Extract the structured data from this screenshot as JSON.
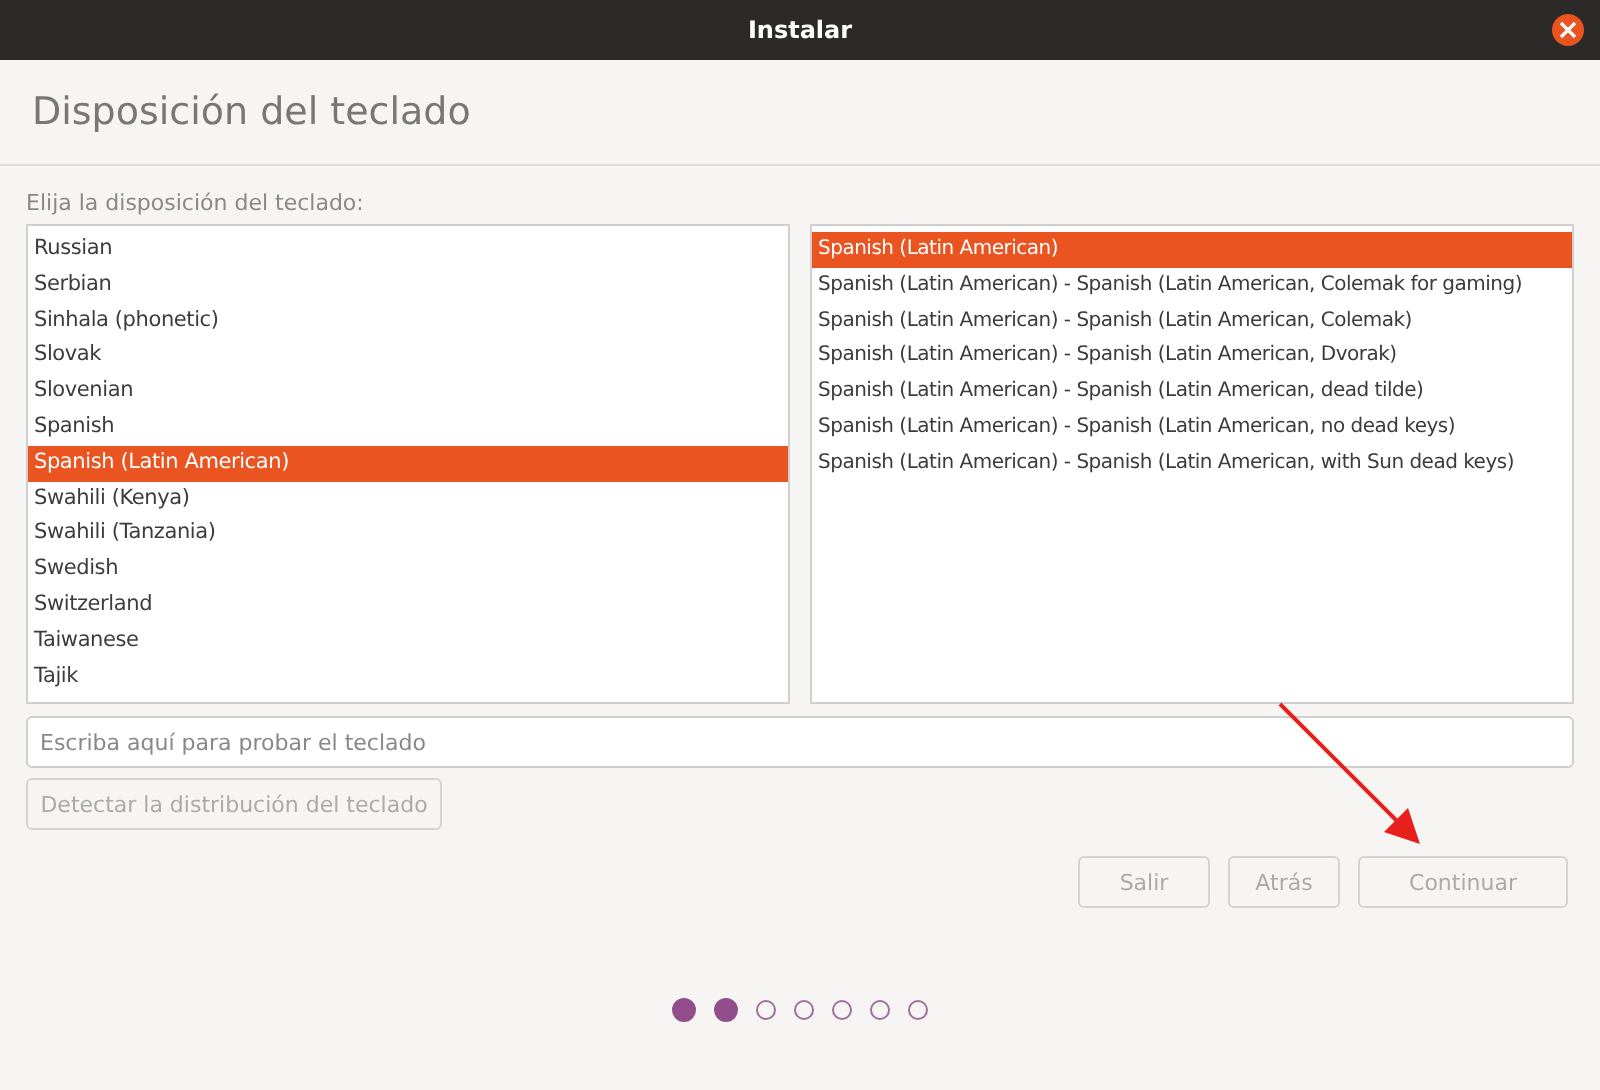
{
  "window": {
    "title": "Instalar"
  },
  "heading": "Disposición del teclado",
  "list_label": "Elija la disposición del teclado:",
  "layouts": [
    {
      "label": "Russian",
      "selected": false
    },
    {
      "label": "Serbian",
      "selected": false
    },
    {
      "label": "Sinhala (phonetic)",
      "selected": false
    },
    {
      "label": "Slovak",
      "selected": false
    },
    {
      "label": "Slovenian",
      "selected": false
    },
    {
      "label": "Spanish",
      "selected": false
    },
    {
      "label": "Spanish (Latin American)",
      "selected": true
    },
    {
      "label": "Swahili (Kenya)",
      "selected": false
    },
    {
      "label": "Swahili (Tanzania)",
      "selected": false
    },
    {
      "label": "Swedish",
      "selected": false
    },
    {
      "label": "Switzerland",
      "selected": false
    },
    {
      "label": "Taiwanese",
      "selected": false
    },
    {
      "label": "Tajik",
      "selected": false
    }
  ],
  "variants": [
    {
      "label": "Spanish (Latin American)",
      "selected": true
    },
    {
      "label": "Spanish (Latin American) - Spanish (Latin American, Colemak for gaming)",
      "selected": false
    },
    {
      "label": "Spanish (Latin American) - Spanish (Latin American, Colemak)",
      "selected": false
    },
    {
      "label": "Spanish (Latin American) - Spanish (Latin American, Dvorak)",
      "selected": false
    },
    {
      "label": "Spanish (Latin American) - Spanish (Latin American, dead tilde)",
      "selected": false
    },
    {
      "label": "Spanish (Latin American) - Spanish (Latin American, no dead keys)",
      "selected": false
    },
    {
      "label": "Spanish (Latin American) - Spanish (Latin American, with Sun dead keys)",
      "selected": false
    }
  ],
  "test_field": {
    "placeholder": "Escriba aquí para probar el teclado"
  },
  "detect_button": {
    "label": "Detectar la distribución del teclado",
    "disabled": true
  },
  "buttons": [
    {
      "label": "Salir",
      "disabled": true
    },
    {
      "label": "Atrás",
      "disabled": true
    },
    {
      "label": "Continuar",
      "disabled": true
    }
  ],
  "steps": [
    {
      "done": true
    },
    {
      "done": true
    },
    {
      "done": false
    },
    {
      "done": false
    },
    {
      "done": false
    },
    {
      "done": false
    },
    {
      "done": false
    }
  ]
}
